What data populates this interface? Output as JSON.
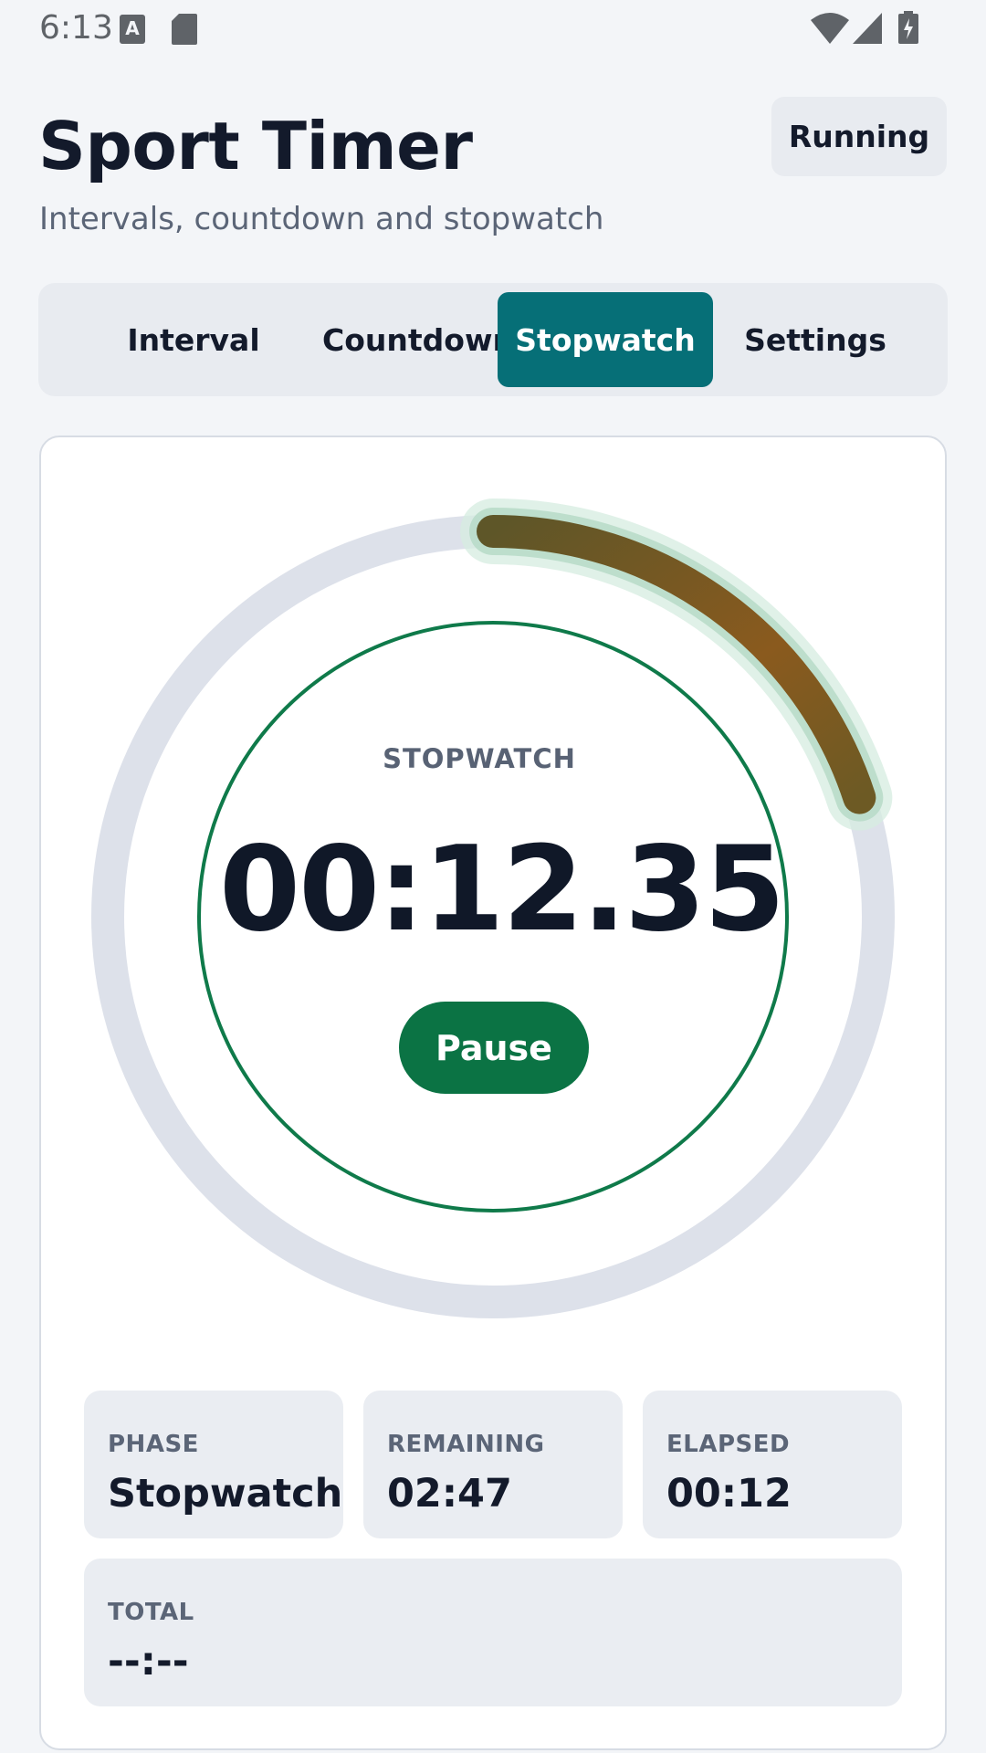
{
  "status_bar": {
    "time": "6:13",
    "left_icons": [
      "text-a-icon",
      "sd-card-icon"
    ],
    "right_icons": [
      "wifi-icon",
      "signal-icon",
      "battery-charging-icon"
    ]
  },
  "header": {
    "title": "Sport Timer",
    "subtitle": "Intervals, countdown and stopwatch",
    "status_badge": "Running"
  },
  "tabs": [
    {
      "label": "Interval",
      "active": false
    },
    {
      "label": "Countdown",
      "active": false
    },
    {
      "label": "Stopwatch",
      "active": true
    },
    {
      "label": "Settings",
      "active": false
    }
  ],
  "timer": {
    "mode_label": "STOPWATCH",
    "readout": "00:12.35",
    "pause_label": "Pause",
    "progress_fraction": 0.2
  },
  "stats": [
    {
      "label": "PHASE",
      "value": "Stopwatch"
    },
    {
      "label": "REMAINING",
      "value": "02:47"
    },
    {
      "label": "ELAPSED",
      "value": "00:12"
    }
  ],
  "total": {
    "label": "TOTAL",
    "value": "--:--"
  },
  "colors": {
    "accent_tab": "#066f77",
    "pause_button": "#0b7344",
    "inner_ring": "#0f7a4a",
    "track": "#dde1ea",
    "progress_arc_start": "#5e5628",
    "progress_arc_mid": "#8a5a1e"
  }
}
